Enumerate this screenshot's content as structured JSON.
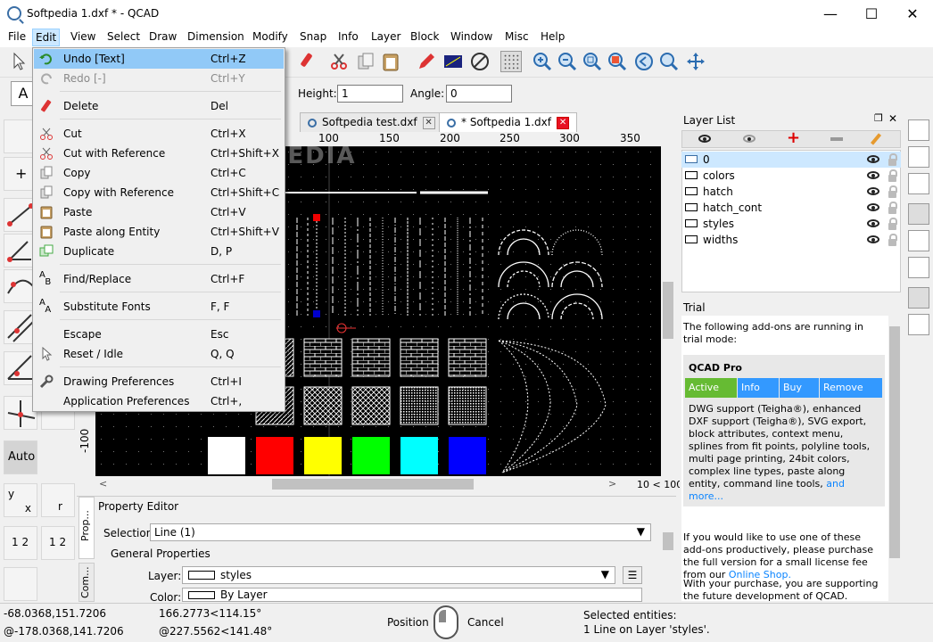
{
  "window": {
    "title": "Softpedia 1.dxf * - QCAD"
  },
  "menubar": [
    "File",
    "Edit",
    "View",
    "Select",
    "Draw",
    "Dimension",
    "Modify",
    "Snap",
    "Info",
    "Layer",
    "Block",
    "Window",
    "Misc",
    "Help"
  ],
  "options": {
    "height_label": "Height:",
    "height_value": "1",
    "angle_label": "Angle:",
    "angle_value": "0"
  },
  "tabs": [
    {
      "label": "Softpedia test.dxf"
    },
    {
      "label": "* Softpedia 1.dxf"
    }
  ],
  "ruler": {
    "h_ticks": [
      "100",
      "150",
      "200",
      "250",
      "300",
      "350"
    ],
    "v_ticks": [
      "-100"
    ]
  },
  "zoom_label": "10 < 100",
  "watermark": "SOFTPEDIA",
  "edit_menu": {
    "items": [
      {
        "label": "Undo [Text]",
        "shortcut": "Ctrl+Z"
      },
      {
        "label": "Redo [-]",
        "shortcut": "Ctrl+Y"
      },
      {
        "label": "Delete",
        "shortcut": "Del"
      },
      {
        "label": "Cut",
        "shortcut": "Ctrl+X"
      },
      {
        "label": "Cut with Reference",
        "shortcut": "Ctrl+Shift+X"
      },
      {
        "label": "Copy",
        "shortcut": "Ctrl+C"
      },
      {
        "label": "Copy with Reference",
        "shortcut": "Ctrl+Shift+C"
      },
      {
        "label": "Paste",
        "shortcut": "Ctrl+V"
      },
      {
        "label": "Paste along Entity",
        "shortcut": "Ctrl+Shift+V"
      },
      {
        "label": "Duplicate",
        "shortcut": "D, P"
      },
      {
        "label": "Find/Replace",
        "shortcut": "Ctrl+F"
      },
      {
        "label": "Substitute Fonts",
        "shortcut": "F, F"
      },
      {
        "label": "Escape",
        "shortcut": "Esc"
      },
      {
        "label": "Reset / Idle",
        "shortcut": "Q, Q"
      },
      {
        "label": "Drawing Preferences",
        "shortcut": "Ctrl+I"
      },
      {
        "label": "Application Preferences",
        "shortcut": "Ctrl+,"
      }
    ]
  },
  "auto_label": "Auto",
  "layer_list": {
    "title": "Layer List",
    "layers": [
      {
        "name": "0"
      },
      {
        "name": "colors"
      },
      {
        "name": "hatch"
      },
      {
        "name": "hatch_cont"
      },
      {
        "name": "styles"
      },
      {
        "name": "widths"
      }
    ]
  },
  "trial": {
    "title": "Trial",
    "intro": "The following add-ons are running in trial mode:",
    "product": "QCAD Pro",
    "buttons": [
      "Active",
      "Info",
      "Buy",
      "Remove"
    ],
    "desc": "DWG support (Teigha®), enhanced DXF support (Teigha®), SVG export, block attributes, context menu, splines from fit points, polyline tools, multi page printing, 24bit colors, complex line types, paste along entity, command line tools,",
    "more_link": "and more...",
    "para2": "If you would like to use one of these add-ons productively, please purchase the full version for a small license fee from our",
    "shop_link": "Online Shop.",
    "para3": "With your purchase, you are supporting the future development of QCAD."
  },
  "property_editor": {
    "title": "Property Editor",
    "side_tabs": [
      "Prop...",
      "Com..."
    ],
    "selection_label": "Selection:",
    "selection_value": "Line (1)",
    "group": "General Properties",
    "layer_label": "Layer:",
    "layer_value": "styles",
    "color_label": "Color:",
    "color_value": "By Layer"
  },
  "status": {
    "coord1": "-68.0368,151.7206",
    "coord2": "@-178.0368,141.7206",
    "polar1": "166.2773<114.15°",
    "polar2": "@227.5562<141.48°",
    "mouse_left": "Position",
    "mouse_right": "Cancel",
    "sel_title": "Selected entities:",
    "sel_value": "1 Line on Layer 'styles'."
  },
  "colors": {
    "accent": "#91c9f7",
    "canvas": "#000000",
    "link": "#0a84ff",
    "trial_btn": "#3399ff",
    "trial_active": "#66bb33"
  },
  "swatches": [
    "#ffffff",
    "#ff0000",
    "#ffff00",
    "#00ff00",
    "#00ffff",
    "#0000ff"
  ]
}
